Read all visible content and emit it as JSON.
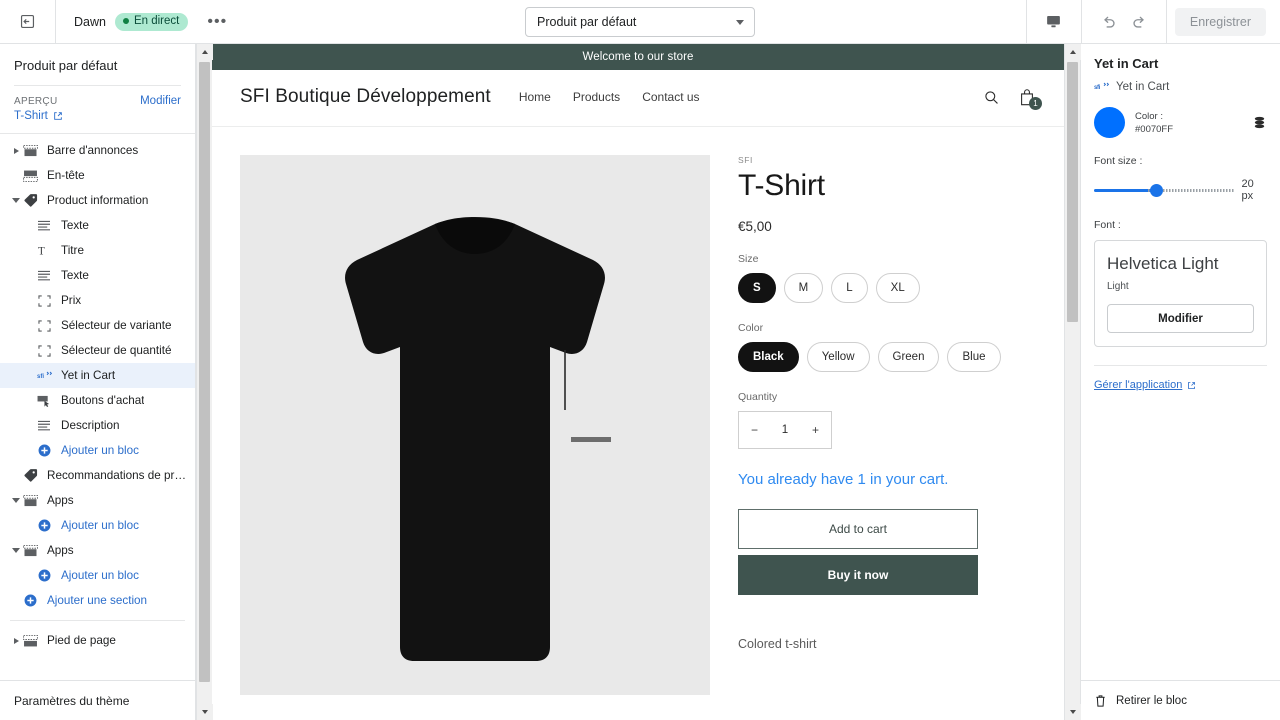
{
  "topbar": {
    "exit_icon": "exit-editor-icon",
    "theme_name": "Dawn",
    "live_badge": "En direct",
    "more_menu": "•••",
    "page_selector_value": "Produit par défaut",
    "device_icon": "desktop-icon",
    "undo_icon": "undo-icon",
    "redo_icon": "redo-icon",
    "save_label": "Enregistrer"
  },
  "sidebar": {
    "title": "Produit par défaut",
    "preview_label": "APERÇU",
    "edit_link": "Modifier",
    "preview_page": "T-Shirt",
    "footer_label": "Paramètres du thème",
    "tree": [
      {
        "label": "Barre d'annonces",
        "icon": "section-icon",
        "twisty": "closed",
        "level": 0
      },
      {
        "label": "En-tête",
        "icon": "header-icon",
        "twisty": "none",
        "level": 0
      },
      {
        "label": "Product information",
        "icon": "tag-icon",
        "twisty": "open",
        "level": 0
      },
      {
        "label": "Texte",
        "icon": "text-icon",
        "twisty": "none",
        "level": 1
      },
      {
        "label": "Titre",
        "icon": "title-icon",
        "twisty": "none",
        "level": 1
      },
      {
        "label": "Texte",
        "icon": "text-icon",
        "twisty": "none",
        "level": 1
      },
      {
        "label": "Prix",
        "icon": "block-icon",
        "twisty": "none",
        "level": 1
      },
      {
        "label": "Sélecteur de variante",
        "icon": "block-icon",
        "twisty": "none",
        "level": 1
      },
      {
        "label": "Sélecteur de quantité",
        "icon": "block-icon",
        "twisty": "none",
        "level": 1
      },
      {
        "label": "Yet in Cart",
        "icon": "app-block-icon",
        "twisty": "none",
        "level": 1,
        "selected": true
      },
      {
        "label": "Boutons d'achat",
        "icon": "buy-buttons-icon",
        "twisty": "none",
        "level": 1
      },
      {
        "label": "Description",
        "icon": "text-icon",
        "twisty": "none",
        "level": 1
      },
      {
        "label": "Ajouter un bloc",
        "icon": "plus-circle-icon",
        "twisty": "none",
        "level": 1,
        "link": true
      },
      {
        "label": "Recommandations de produits",
        "icon": "tag-icon",
        "twisty": "none",
        "level": 0
      },
      {
        "label": "Apps",
        "icon": "section-icon",
        "twisty": "open",
        "level": 0
      },
      {
        "label": "Ajouter un bloc",
        "icon": "plus-circle-icon",
        "twisty": "none",
        "level": 1,
        "link": true
      },
      {
        "label": "Apps",
        "icon": "section-icon",
        "twisty": "open",
        "level": 0
      },
      {
        "label": "Ajouter un bloc",
        "icon": "plus-circle-icon",
        "twisty": "none",
        "level": 1,
        "link": true
      },
      {
        "label": "Ajouter une section",
        "icon": "plus-circle-icon",
        "twisty": "none",
        "level": 0,
        "link": true
      },
      {
        "label": "Pied de page",
        "icon": "footer-icon",
        "twisty": "closed",
        "level": 0,
        "separator_before": true
      }
    ]
  },
  "preview": {
    "announcement": "Welcome to our store",
    "store_name": "SFI Boutique Développement",
    "nav": [
      "Home",
      "Products",
      "Contact us"
    ],
    "search_icon": "search-icon",
    "cart_icon": "cart-icon",
    "cart_count": "1",
    "product": {
      "vendor": "SFI",
      "title": "T-Shirt",
      "price": "€5,00",
      "size_label": "Size",
      "sizes": [
        {
          "label": "S",
          "selected": true
        },
        {
          "label": "M",
          "selected": false
        },
        {
          "label": "L",
          "selected": false
        },
        {
          "label": "XL",
          "selected": false
        }
      ],
      "color_label": "Color",
      "colors": [
        {
          "label": "Black",
          "selected": true
        },
        {
          "label": "Yellow",
          "selected": false
        },
        {
          "label": "Green",
          "selected": false
        },
        {
          "label": "Blue",
          "selected": false
        }
      ],
      "quantity_label": "Quantity",
      "quantity_minus": "−",
      "quantity_value": "1",
      "quantity_plus": "+",
      "cart_notice": "You already have 1 in your cart.",
      "add_to_cart": "Add to cart",
      "buy_now": "Buy it now",
      "description": "Colored t-shirt"
    }
  },
  "right_panel": {
    "title": "Yet in Cart",
    "app_block_label": "Yet in Cart",
    "color_label": "Color :",
    "color_value": "#0070FF",
    "layers_icon": "layers-icon",
    "font_size_label": "Font size :",
    "font_size_value": "20 px",
    "font_label": "Font :",
    "font_name": "Helvetica Light",
    "font_weight": "Light",
    "font_edit_button": "Modifier",
    "manage_app": "Gérer l'application",
    "remove_block": "Retirer le bloc",
    "remove_icon": "trash-icon"
  },
  "colors": {
    "accent_blue": "#0070FF",
    "link_blue": "#2c6ecb",
    "store_dark": "#3f544f",
    "live_badge_bg": "#aee9d1"
  }
}
